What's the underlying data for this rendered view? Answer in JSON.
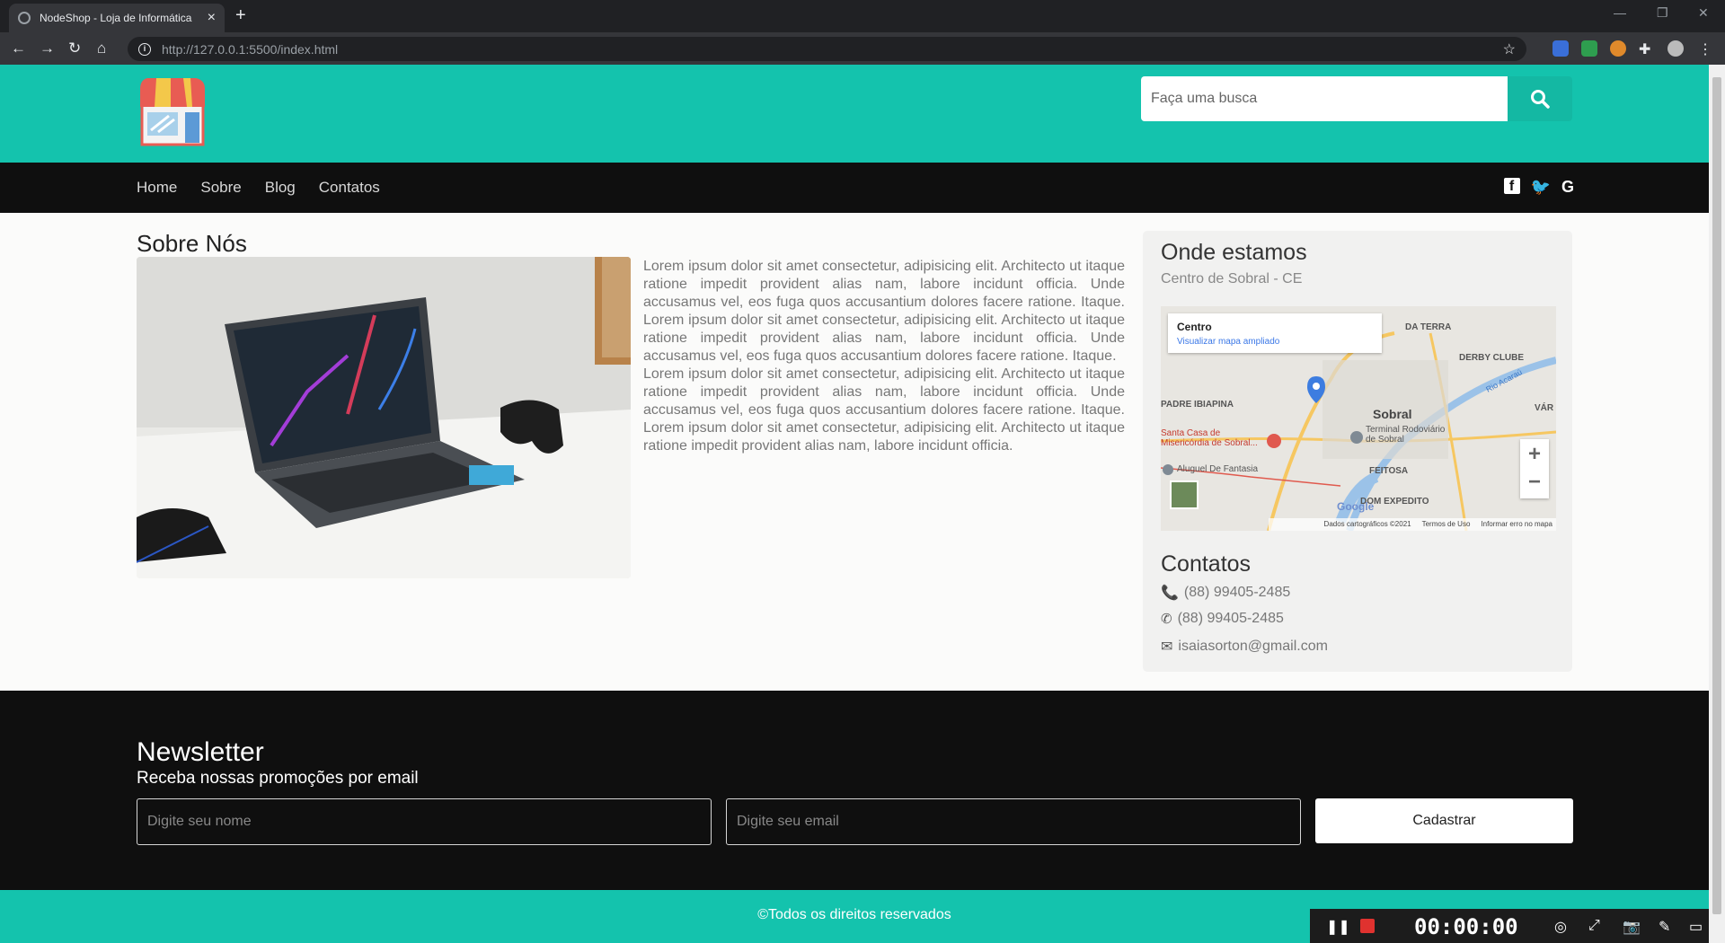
{
  "browser": {
    "tab_title": "NodeShop - Loja de Informática",
    "url": "http://127.0.0.1:5500/index.html"
  },
  "header": {
    "search_placeholder": "Faça uma busca"
  },
  "nav": {
    "links": [
      "Home",
      "Sobre",
      "Blog",
      "Contatos"
    ],
    "social": [
      "facebook-icon",
      "twitter-icon",
      "google-icon"
    ]
  },
  "about": {
    "title": "Sobre Nós",
    "paragraphs": [
      "Lorem ipsum dolor sit amet consectetur, adipisicing elit. Architecto ut itaque ratione impedit provident alias nam, labore incidunt officia. Unde accusamus vel, eos fuga quos accusantium dolores facere ratione. Itaque. Lorem ipsum dolor sit amet consectetur, adipisicing elit. Architecto ut itaque ratione impedit provident alias nam, labore incidunt officia. Unde accusamus vel, eos fuga quos accusantium dolores facere ratione. Itaque.",
      "Lorem ipsum dolor sit amet consectetur, adipisicing elit. Architecto ut itaque ratione impedit provident alias nam, labore incidunt officia. Unde accusamus vel, eos fuga quos accusantium dolores facere ratione. Itaque. Lorem ipsum dolor sit amet consectetur, adipisicing elit. Architecto ut itaque ratione impedit provident alias nam, labore incidunt officia."
    ]
  },
  "location": {
    "title": "Onde estamos",
    "subtitle": "Centro de Sobral - CE",
    "map": {
      "place_name": "Centro",
      "enlarge_link": "Visualizar mapa ampliado",
      "labels": [
        "DERBY CLUBE",
        "PADRE IBIAPINA",
        "Sobral",
        "Terminal Rodoviário de Sobral",
        "Santa Casa de Misericórdia de Sobral...",
        "Aluguel De Fantasia",
        "FEITOSA",
        "DOM EXPEDITO",
        "Rio Acaraú",
        "DA TERRA",
        "VÁR"
      ],
      "attribution": "Dados cartográficos ©2021",
      "terms": "Termos de Uso",
      "report": "Informar erro no mapa",
      "zoom_in": "+",
      "zoom_out": "−",
      "google": "Google"
    }
  },
  "contacts": {
    "title": "Contatos",
    "phone": "(88) 99405-2485",
    "whatsapp": "(88) 99405-2485",
    "email": "isaiasorton@gmail.com"
  },
  "newsletter": {
    "title": "Newsletter",
    "subtitle": "Receba nossas promoções por email",
    "name_placeholder": "Digite seu nome",
    "email_placeholder": "Digite seu email",
    "button": "Cadastrar"
  },
  "footer": {
    "text": "©Todos os direitos reservados"
  },
  "recorder": {
    "time": "00:00:00"
  },
  "colors": {
    "brand_teal": "#14c3ad",
    "dark": "#0f0f0f"
  }
}
